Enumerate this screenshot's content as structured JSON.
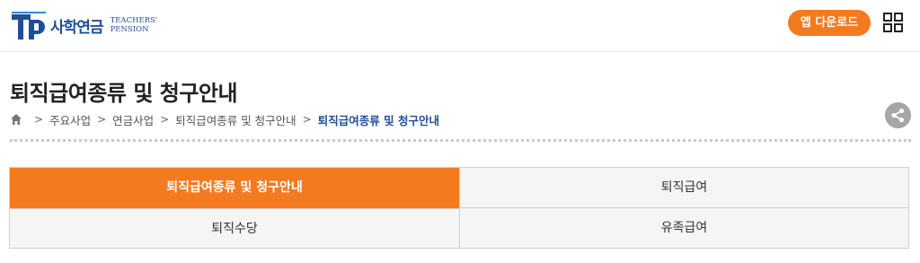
{
  "header": {
    "logo_kr": "사학연금",
    "logo_en_line1": "TEACHERS'",
    "logo_en_line2": "PENSION",
    "logo_mark": "TP",
    "app_download_label": "앱 다운로드",
    "menu_icon": "grid-menu-icon"
  },
  "page": {
    "title": "퇴직급여종류 및 청구안내"
  },
  "breadcrumb": {
    "home_icon": "home-icon",
    "items": [
      "주요사업",
      "연금사업",
      "퇴직급여종류 및 청구안내",
      "퇴직급여종류 및 청구안내"
    ]
  },
  "share_icon": "share-icon",
  "tabs": [
    {
      "label": "퇴직급여종류 및 청구안내",
      "active": true
    },
    {
      "label": "퇴직급여",
      "active": false
    },
    {
      "label": "퇴직수당",
      "active": false
    },
    {
      "label": "유족급여",
      "active": false
    }
  ],
  "colors": {
    "accent": "#f47a20",
    "brand": "#1f4f95",
    "share_bg": "#a6a6a6"
  }
}
